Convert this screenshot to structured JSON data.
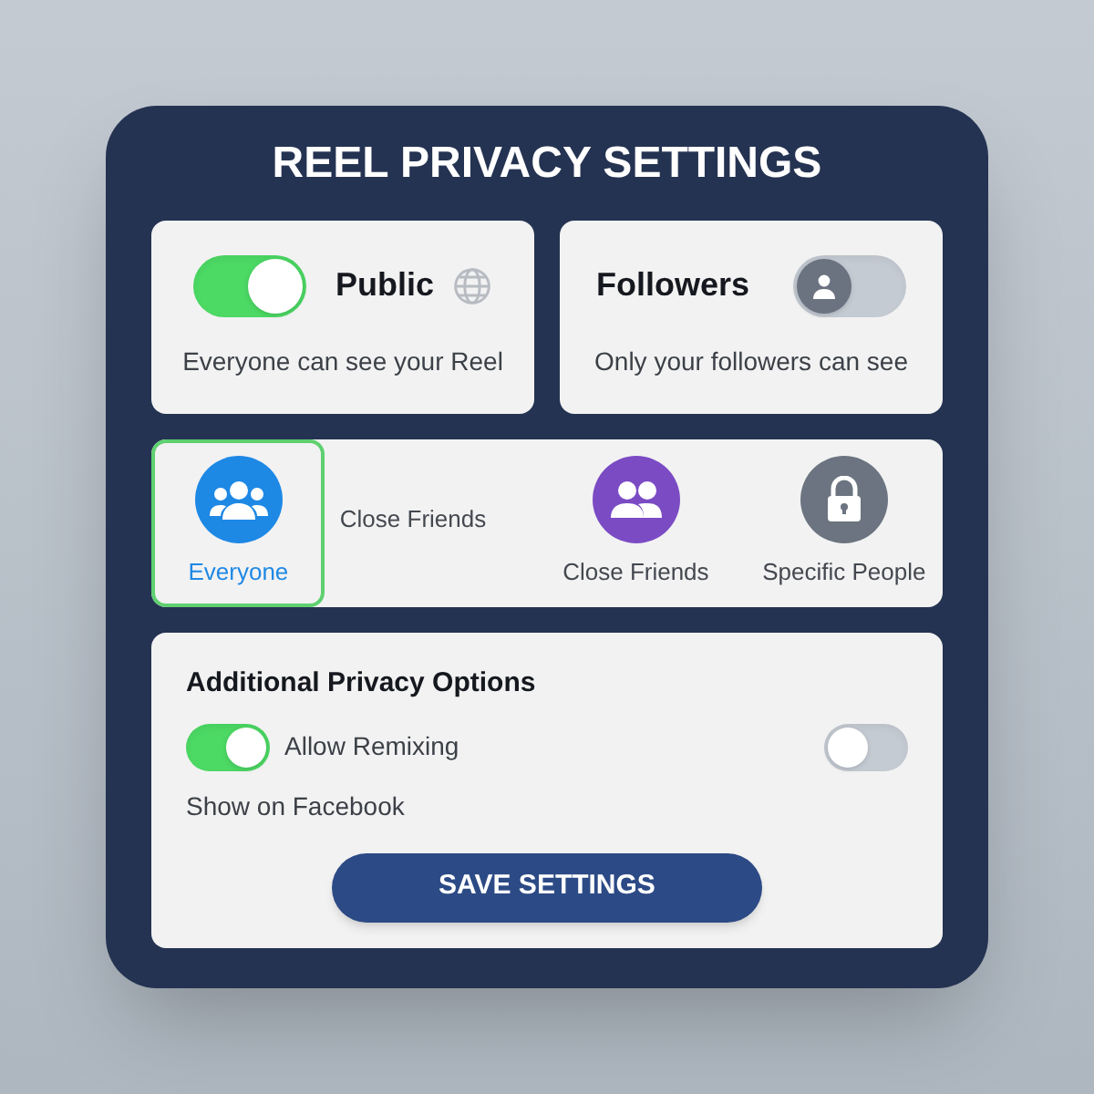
{
  "title": "REEL PRIVACY SETTINGS",
  "visibility": [
    {
      "label": "Public",
      "description": "Everyone can see your Reel",
      "on": true
    },
    {
      "label": "Followers",
      "description": "Only your followers can see",
      "on": false
    }
  ],
  "audience": [
    {
      "kind": "option",
      "label": "Everyone",
      "selected": true,
      "color": "#1e88e5"
    },
    {
      "kind": "text",
      "label": "Close Friends"
    },
    {
      "kind": "option",
      "label": "Close Friends",
      "selected": false,
      "color": "#7b4bc4"
    },
    {
      "kind": "option",
      "label": "Specific People",
      "selected": false,
      "color": "#6b7480"
    }
  ],
  "options": {
    "title": "Additional Privacy Options",
    "items": [
      {
        "kind": "toggle_label",
        "label": "Allow Remixing",
        "on": true
      },
      {
        "kind": "toggle",
        "on": false
      },
      {
        "kind": "label",
        "label": "Show on Facebook"
      }
    ]
  },
  "save_button": "SAVE SETTINGS"
}
